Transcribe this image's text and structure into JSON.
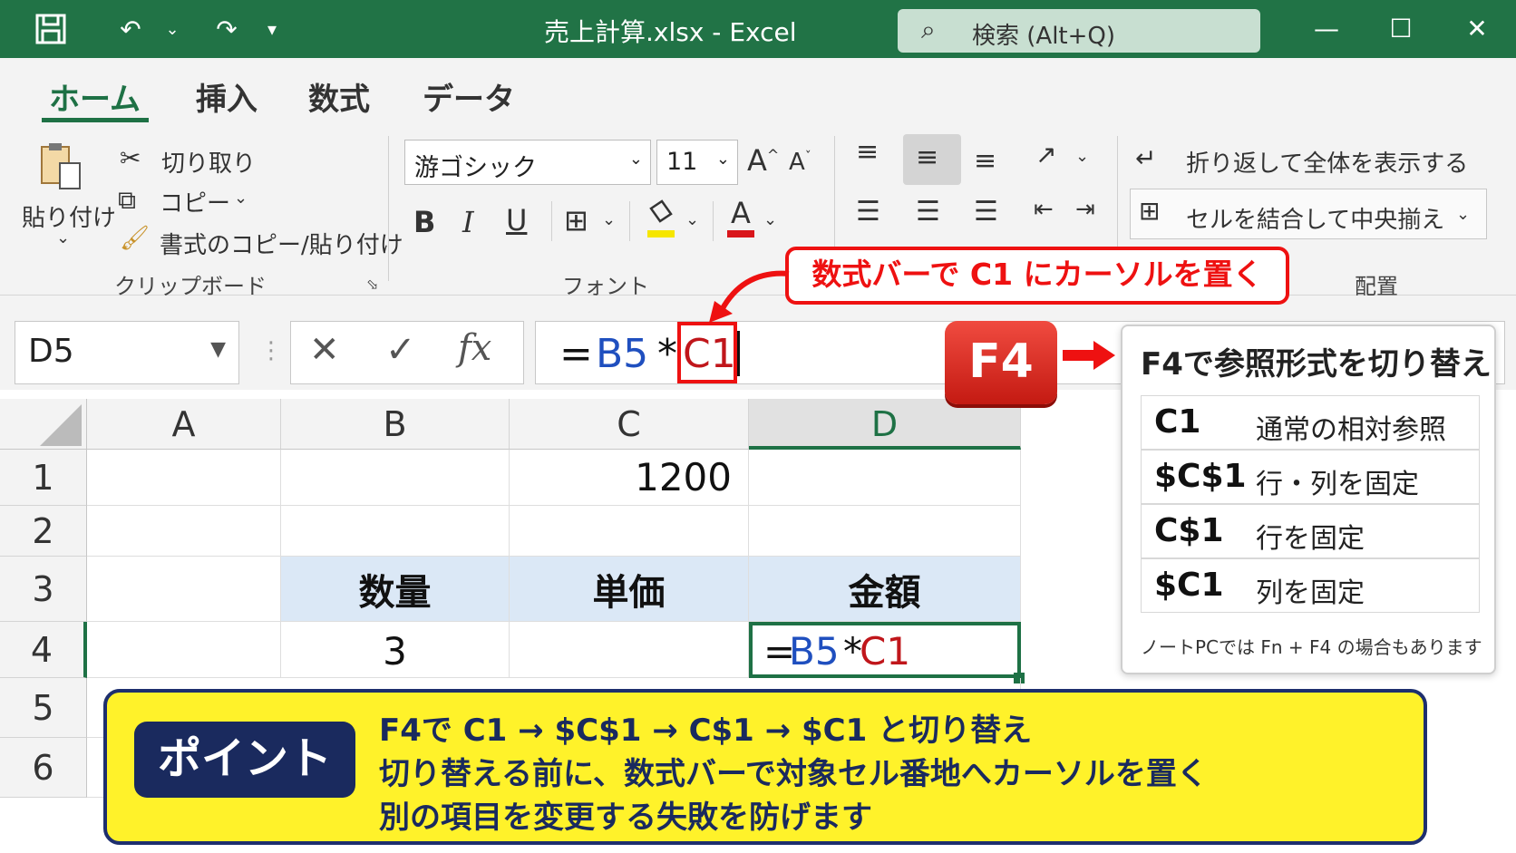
{
  "window": {
    "title": "売上計算.xlsx - Excel",
    "search_label": "検索 (Alt+Q)"
  },
  "tabs": [
    "ホーム",
    "挿入",
    "数式",
    "データ"
  ],
  "ribbon": {
    "clipboard": {
      "paste": "貼り付け",
      "cut": "切り取り",
      "copy": "コピー",
      "format_painter": "書式のコピー/貼り付け",
      "group_label": "クリップボード"
    },
    "font": {
      "font_name": "游ゴシック",
      "font_size": "11",
      "group_label": "フォント"
    },
    "alignment": {
      "wrap_text": "折り返して全体を表示する",
      "merge_center": "セルを結合して中央揃え",
      "group_label": "配置"
    }
  },
  "formula_bar": {
    "name_box": "D5",
    "formula_eq": "=",
    "formula_ref1": "B5",
    "formula_op": "*",
    "formula_ref2": "C1"
  },
  "grid": {
    "columns": [
      "A",
      "B",
      "C",
      "D"
    ],
    "rows": [
      "1",
      "2",
      "3",
      "4",
      "5",
      "6"
    ],
    "c1": "1200",
    "b3": "数量",
    "c3": "単価",
    "d3": "金額",
    "b4": "3",
    "d4_eq": "=",
    "d4_ref1": "B5",
    "d4_op": "*",
    "d4_ref2": "C1"
  },
  "callout_formula": "数式バーで C1 にカーソルを置く",
  "f4_key": "F4",
  "panel": {
    "title": "F4で参照形式を切り替え",
    "rows": [
      {
        "code": "C1",
        "desc": "通常の相対参照"
      },
      {
        "code": "$C$1",
        "desc": "行・列を固定"
      },
      {
        "code": "C$1",
        "desc": "行を固定"
      },
      {
        "code": "$C1",
        "desc": "列を固定"
      }
    ],
    "note": "ノートPCでは Fn + F4 の場合もあります"
  },
  "point": {
    "badge": "ポイント",
    "line1": "F4で C1 → $C$1 → C$1 → $C1 と切り替え",
    "line2": "切り替える前に、数式バーで対象セル番地へカーソルを置く",
    "line3": "別の項目を変更する失敗を防げます"
  },
  "colors": {
    "excel_green": "#217346",
    "reference_blue": "#1f4fbf",
    "reference_red": "#c0161b",
    "highlight_red": "#e11111",
    "point_yellow": "#fff22a",
    "point_navy": "#1a2a5e",
    "header_fill": "#dbe8f6"
  },
  "icons": [
    "save-icon",
    "undo-icon",
    "redo-icon",
    "customize-icon",
    "search-icon",
    "minimize-icon",
    "maximize-icon",
    "close-icon",
    "paste-icon",
    "cut-icon",
    "copy-icon",
    "format-painter-icon",
    "bold-icon",
    "italic-icon",
    "underline-icon",
    "borders-icon",
    "fill-color-icon",
    "font-color-icon",
    "align-top-icon",
    "align-middle-icon",
    "align-bottom-icon",
    "orientation-icon",
    "align-left-icon",
    "align-center-icon",
    "align-right-icon",
    "decrease-indent-icon",
    "increase-indent-icon",
    "wrap-text-icon",
    "merge-icon",
    "cancel-icon",
    "enter-icon",
    "fx-icon"
  ]
}
